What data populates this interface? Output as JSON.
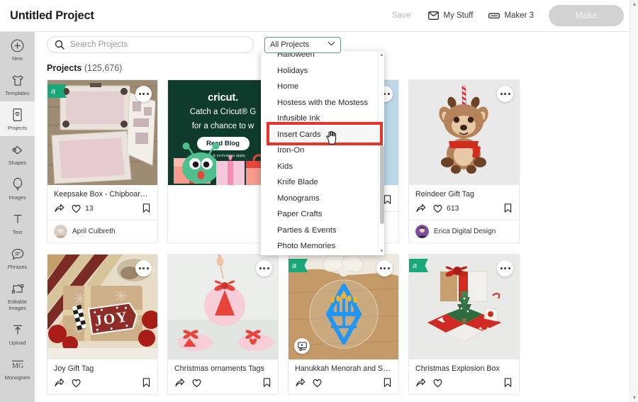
{
  "header": {
    "project_title": "Untitled Project",
    "save_label": "Save",
    "my_stuff_label": "My Stuff",
    "machine_label": "Maker 3",
    "make_label": "Make"
  },
  "sidebar": {
    "items": [
      {
        "label": "New",
        "icon": "plus-circle-icon",
        "active": false
      },
      {
        "label": "Templates",
        "icon": "shirt-icon",
        "active": false
      },
      {
        "label": "Projects",
        "icon": "projects-card-icon",
        "active": true
      },
      {
        "label": "Shapes",
        "icon": "shapes-icon",
        "active": false
      },
      {
        "label": "Images",
        "icon": "balloon-icon",
        "active": false
      },
      {
        "label": "Text",
        "icon": "text-t-icon",
        "active": false
      },
      {
        "label": "Phrases",
        "icon": "speech-bubble-icon",
        "active": false
      },
      {
        "label": "Editable Images",
        "icon": "editable-images-icon",
        "active": false
      },
      {
        "label": "Upload",
        "icon": "upload-arrow-icon",
        "active": false
      },
      {
        "label": "Monogram",
        "icon": "monogram-icon",
        "active": false
      }
    ]
  },
  "search": {
    "placeholder": "Search Projects",
    "value": ""
  },
  "filter": {
    "selected": "All Projects",
    "expanded": true,
    "options": [
      "Halloween",
      "Holidays",
      "Home",
      "Hostess with the Mostess",
      "Infusible Ink",
      "Insert Cards",
      "Iron-On",
      "Kids",
      "Knife Blade",
      "Monograms",
      "Paper Crafts",
      "Parties & Events",
      "Photo Memories"
    ],
    "highlighted_option": "Insert Cards",
    "highlight_color": "#e8332a"
  },
  "projects": {
    "heading_label": "Projects",
    "count_label": "(125,676)",
    "cards": [
      {
        "title": "Keepsake Box - Chipboard Pi...",
        "likes": "13",
        "author": "April Culbreth",
        "badge": "a",
        "has_video": false,
        "thumb": "keepsake-box-photo"
      },
      {
        "title": "",
        "likes": "",
        "author": "",
        "badge": "",
        "has_video": false,
        "thumb": "cricut-ad",
        "ad": {
          "logo": "cricut.",
          "line1": "Catch a Cricut® G",
          "line2": "for a chance to w",
          "button": "Read Blog",
          "terms": "*Terms & exclusions apply."
        }
      },
      {
        "title": "",
        "likes": "",
        "author": "",
        "badge": "",
        "has_video": false,
        "thumb": "snowflake-photo-hidden"
      },
      {
        "title": "Reindeer Gift Tag",
        "likes": "613",
        "author": "Erica Digital Design",
        "badge": "",
        "has_video": false,
        "thumb": "reindeer-gift-tag-photo"
      },
      {
        "title": "Joy Gift Tag",
        "likes": "",
        "author": "",
        "badge": "",
        "has_video": false,
        "thumb": "joy-gift-tag-photo"
      },
      {
        "title": "Christmas ornaments Tags",
        "likes": "",
        "author": "",
        "badge": "",
        "has_video": false,
        "thumb": "christmas-ornaments-photo"
      },
      {
        "title": "Hanukkah Menorah and Star...",
        "likes": "",
        "author": "",
        "badge": "a",
        "has_video": true,
        "thumb": "hanukkah-menorah-photo"
      },
      {
        "title": "Christmas Explosion Box",
        "likes": "",
        "author": "",
        "badge": "a",
        "has_video": false,
        "thumb": "christmas-explosion-box-photo"
      }
    ]
  }
}
